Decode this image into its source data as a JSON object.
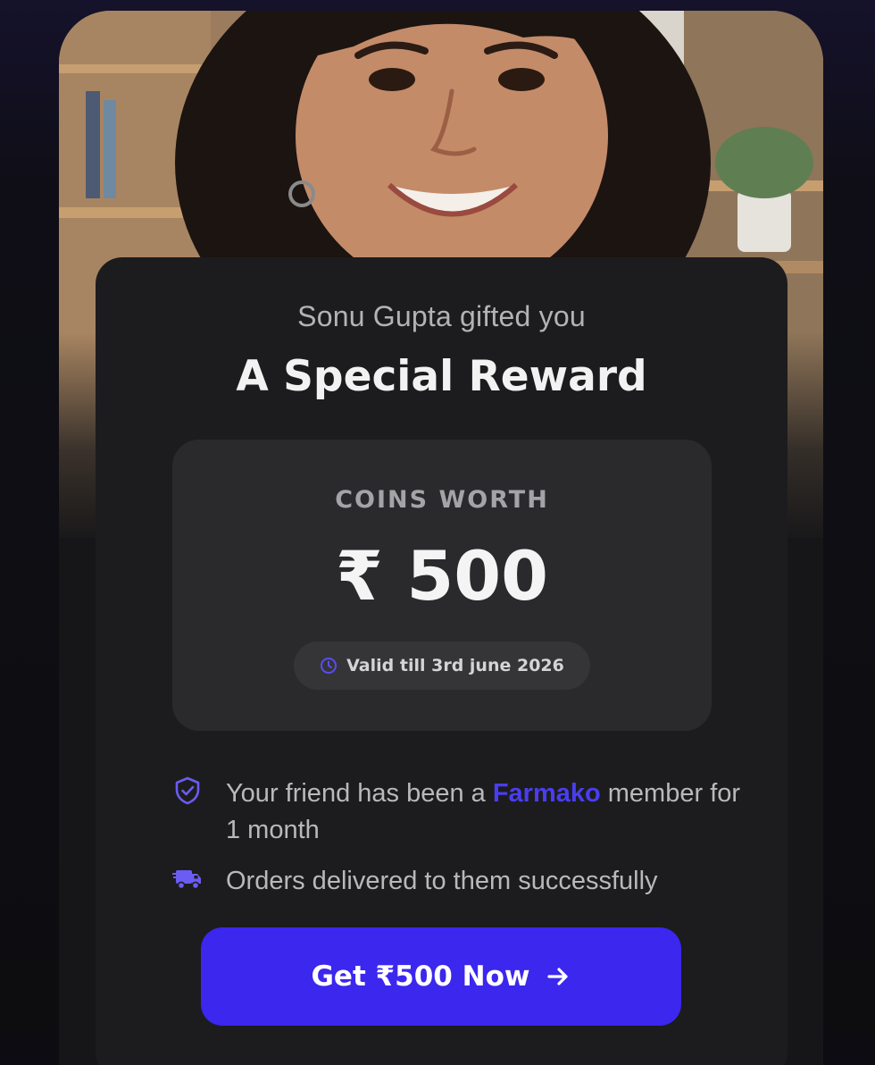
{
  "reward": {
    "gifted_by_text": "Sonu Gupta gifted you",
    "title": "A Special Reward",
    "coins_label": "COINS WORTH",
    "amount": "₹ 500",
    "validity": "Valid till 3rd june 2026"
  },
  "features": [
    {
      "icon": "shield-check-icon",
      "text_before": "Your friend has been a ",
      "brand": "Farmako",
      "text_after": " member for 1 month"
    },
    {
      "icon": "delivery-truck-icon",
      "text": "Orders delivered to them successfully"
    }
  ],
  "cta": {
    "label": "Get ₹500 Now",
    "icon": "arrow-right-icon"
  },
  "colors": {
    "accent": "#3b27ee",
    "brand_text": "#4a3df0",
    "icon_accent": "#6b5cf2",
    "card_bg": "#1c1c1e",
    "coin_box_bg": "#2a2a2c"
  }
}
